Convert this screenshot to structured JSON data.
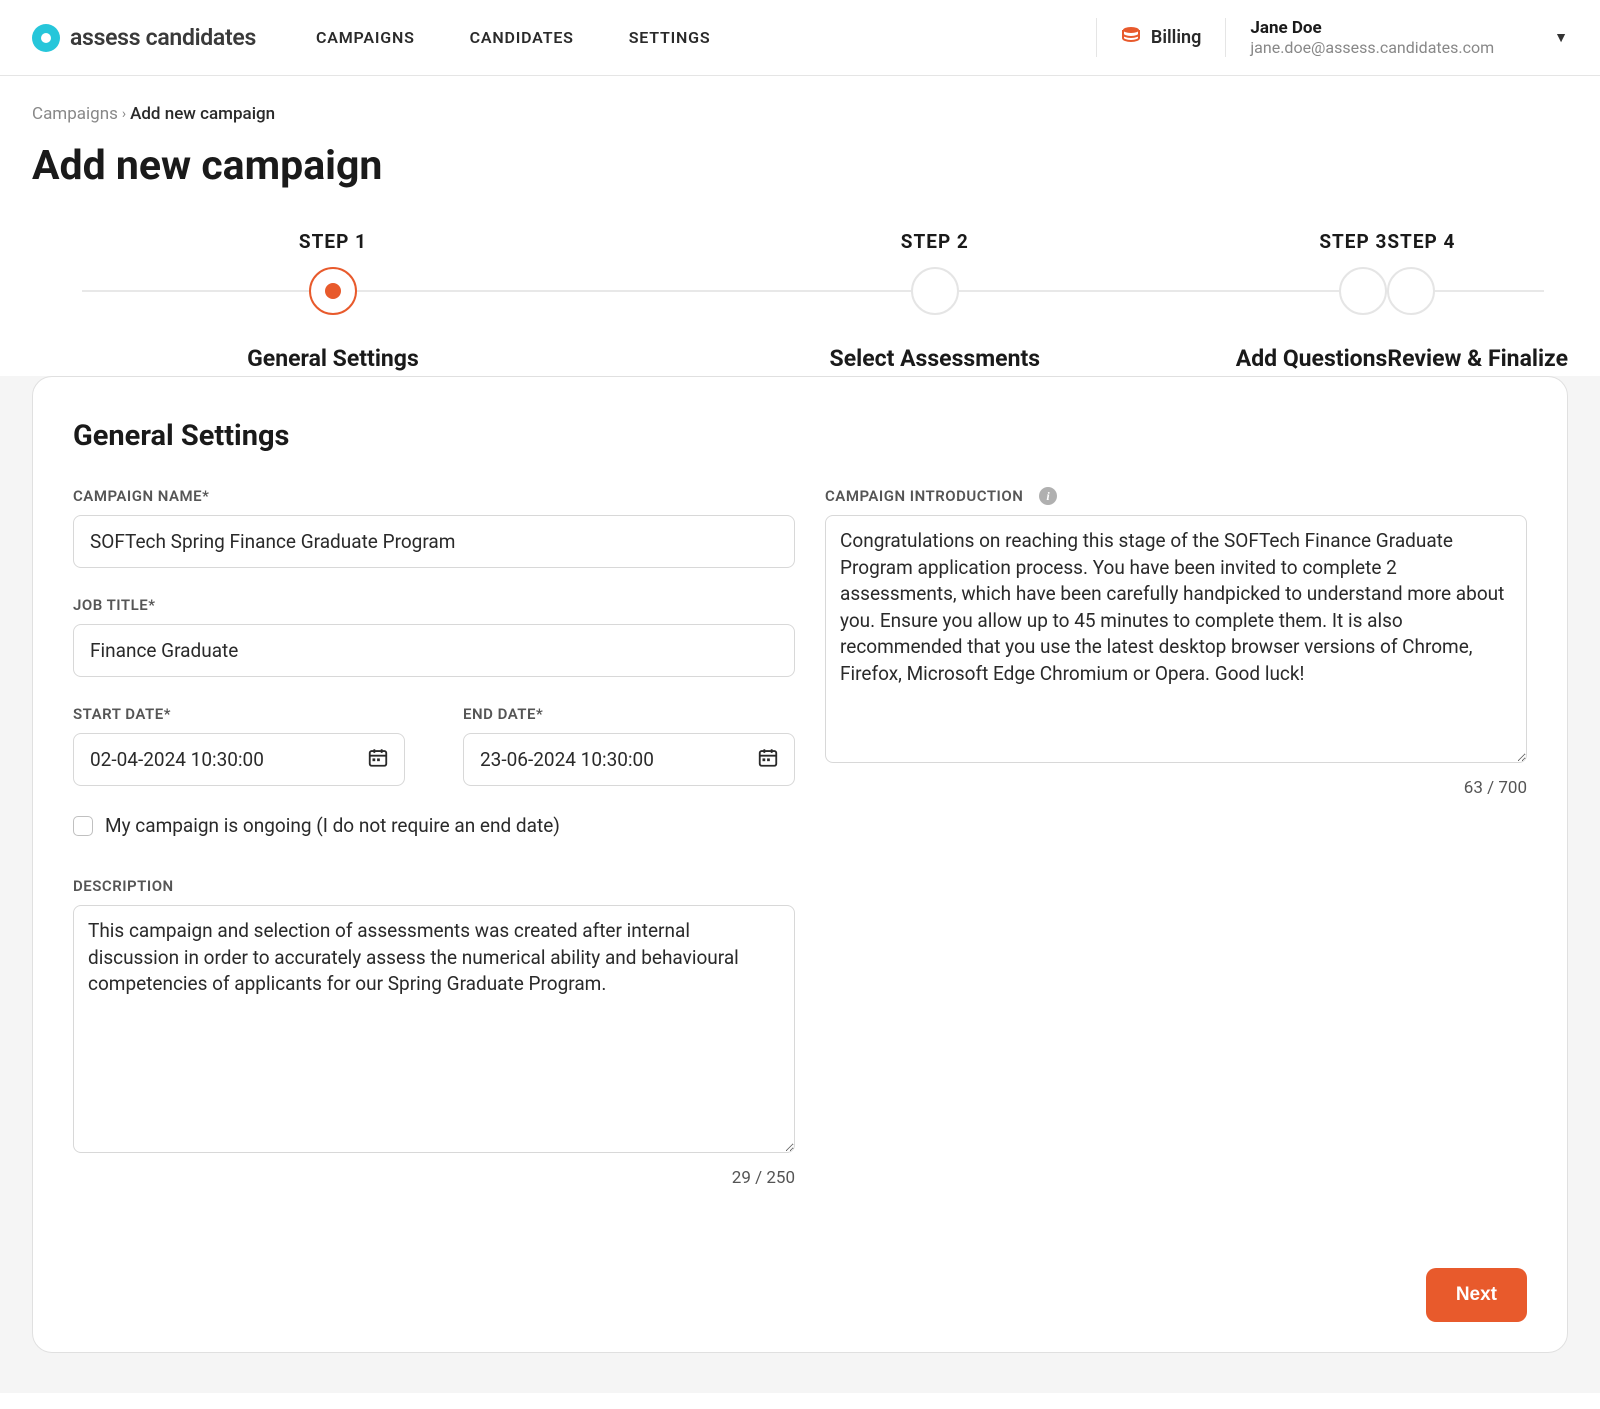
{
  "brand": {
    "name": "assess candidates"
  },
  "nav": {
    "campaigns": "CAMPAIGNS",
    "candidates": "CANDIDATES",
    "settings": "SETTINGS"
  },
  "billing": {
    "label": "Billing"
  },
  "user": {
    "name": "Jane Doe",
    "email": "jane.doe@assess.candidates.com"
  },
  "breadcrumb": {
    "root": "Campaigns",
    "current": "Add new campaign"
  },
  "page": {
    "title": "Add new campaign"
  },
  "steps": [
    {
      "top": "STEP 1",
      "bottom": "General Settings",
      "active": true
    },
    {
      "top": "STEP 2",
      "bottom": "Select Assessments",
      "active": false
    },
    {
      "top": "STEP 3",
      "bottom": "Add Questions",
      "active": false
    },
    {
      "top": "STEP 4",
      "bottom": "Review & Finalize",
      "active": false
    }
  ],
  "card": {
    "title": "General Settings",
    "campaign_name_label": "CAMPAIGN NAME*",
    "campaign_name_value": "SOFTech Spring Finance Graduate Program",
    "job_title_label": "JOB TITLE*",
    "job_title_value": "Finance Graduate",
    "start_date_label": "START DATE*",
    "start_date_value": "02-04-2024 10:30:00",
    "end_date_label": "END DATE*",
    "end_date_value": "23-06-2024 10:30:00",
    "ongoing_label": "My campaign is ongoing (I do not require an end date)",
    "description_label": "DESCRIPTION",
    "description_value": "This campaign and selection of assessments was created after internal discussion in order to accurately assess the numerical ability and behavioural competencies of applicants for our Spring Graduate Program.",
    "description_counter": "29 / 250",
    "intro_label": "CAMPAIGN INTRODUCTION",
    "intro_value": "Congratulations on reaching this stage of the SOFTech Finance Graduate Program application process. You have been invited to complete 2 assessments, which have been carefully handpicked to understand more about you. Ensure you allow up to 45 minutes to complete them. It is also recommended that you use the latest desktop browser versions of Chrome, Firefox, Microsoft Edge Chromium or Opera. Good luck!",
    "intro_counter": "63 / 700",
    "next_label": "Next"
  }
}
